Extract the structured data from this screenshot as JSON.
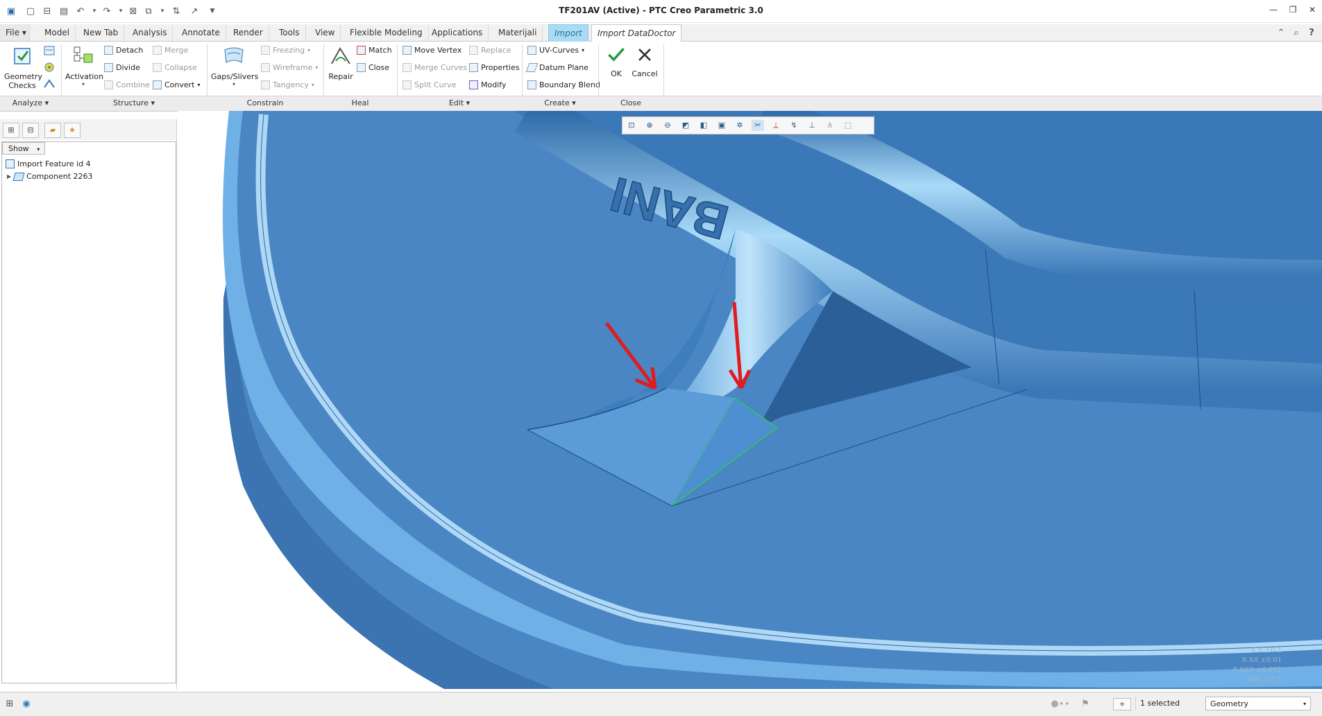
{
  "window": {
    "title": "TF201AV (Active) - PTC Creo Parametric 3.0"
  },
  "tabs": [
    {
      "label": "File",
      "kind": "file"
    },
    {
      "label": "Model"
    },
    {
      "label": "New Tab"
    },
    {
      "label": "Analysis"
    },
    {
      "label": "Annotate"
    },
    {
      "label": "Render"
    },
    {
      "label": "Tools"
    },
    {
      "label": "View"
    },
    {
      "label": "Flexible Modeling"
    },
    {
      "label": "Applications"
    },
    {
      "label": "Materijali"
    },
    {
      "label": "Import",
      "kind": "import"
    },
    {
      "label": "Import DataDoctor",
      "kind": "active"
    }
  ],
  "ribbon": {
    "analyze": {
      "geometry_checks": "Geometry Checks",
      "group": "Analyze"
    },
    "structure": {
      "activation": "Activation",
      "detach": "Detach",
      "divide": "Divide",
      "combine": "Combine",
      "merge": "Merge",
      "collapse": "Collapse",
      "convert": "Convert",
      "group": "Structure"
    },
    "constrain": {
      "gaps": "Gaps/Slivers",
      "freezing": "Freezing",
      "wireframe": "Wireframe",
      "tangency": "Tangency",
      "group": "Constrain"
    },
    "heal": {
      "repair": "Repair",
      "match": "Match",
      "close": "Close",
      "group": "Heal"
    },
    "edit": {
      "move_vertex": "Move Vertex",
      "merge_curves": "Merge Curves",
      "split_curve": "Split Curve",
      "replace": "Replace",
      "properties": "Properties",
      "modify": "Modify",
      "group": "Edit"
    },
    "create": {
      "uv_curves": "UV-Curves",
      "datum_plane": "Datum Plane",
      "boundary_blend": "Boundary Blend",
      "group": "Create"
    },
    "close": {
      "ok": "OK",
      "cancel": "Cancel",
      "group": "Close"
    }
  },
  "tree": {
    "show_label": "Show",
    "items": [
      "Import Feature id 4",
      "Component 2263"
    ]
  },
  "model": {
    "embossed_text": "BANI"
  },
  "tolerance": [
    "X.X ±0.1",
    "X.XX ±0.01",
    "X.XXX ±0.001",
    "ANG ±0.5"
  ],
  "status": {
    "selected": "1 selected",
    "filter": "Geometry"
  },
  "colors": {
    "model_blue": "#4a86c3",
    "arrow": "#e01c1c",
    "highlight": "#2ec85a",
    "import_tab": "#a9dcf3"
  }
}
